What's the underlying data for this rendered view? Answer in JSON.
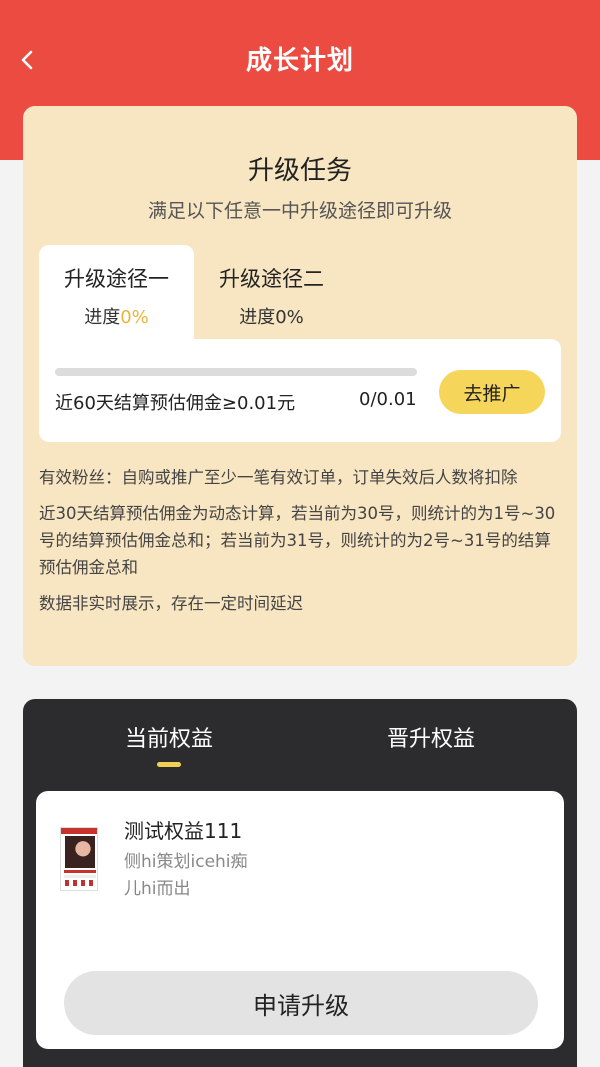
{
  "header": {
    "title": "成长计划",
    "back_icon": "chevron-left-icon",
    "background_color": "#ec4b42"
  },
  "task": {
    "title": "升级任务",
    "subtitle": "满足以下任意一中升级途径即可升级",
    "paths": [
      {
        "name": "升级途径一",
        "progress_label": "进度",
        "progress_value": "0%",
        "active": true
      },
      {
        "name": "升级途径二",
        "progress_label": "进度",
        "progress_value": "0%",
        "active": false
      }
    ],
    "requirement": {
      "text": "近60天结算预估佣金≥0.01元",
      "count": "0/0.01",
      "progress_fraction": 0,
      "button_label": "去推广"
    },
    "notes": [
      "有效粉丝：自购或推广至少一笔有效订单，订单失效后人数将扣除",
      "近30天结算预估佣金为动态计算，若当前为30号，则统计的为1号~30号的结算预估佣金总和；若当前为31号，则统计的为2号~31号的结算预估佣金总和",
      "数据非实时展示，存在一定时间延迟"
    ]
  },
  "benefits": {
    "tabs": [
      {
        "label": "当前权益",
        "active": true
      },
      {
        "label": "晋升权益",
        "active": false
      }
    ],
    "item": {
      "name": "测试权益111",
      "description": "侧hi策划icehi痴儿hi而出"
    },
    "apply_label": "申请升级"
  },
  "colors": {
    "accent_yellow": "#f2cf55",
    "card_beige": "#f8e6c3",
    "dark_panel": "#2c2c2e"
  }
}
